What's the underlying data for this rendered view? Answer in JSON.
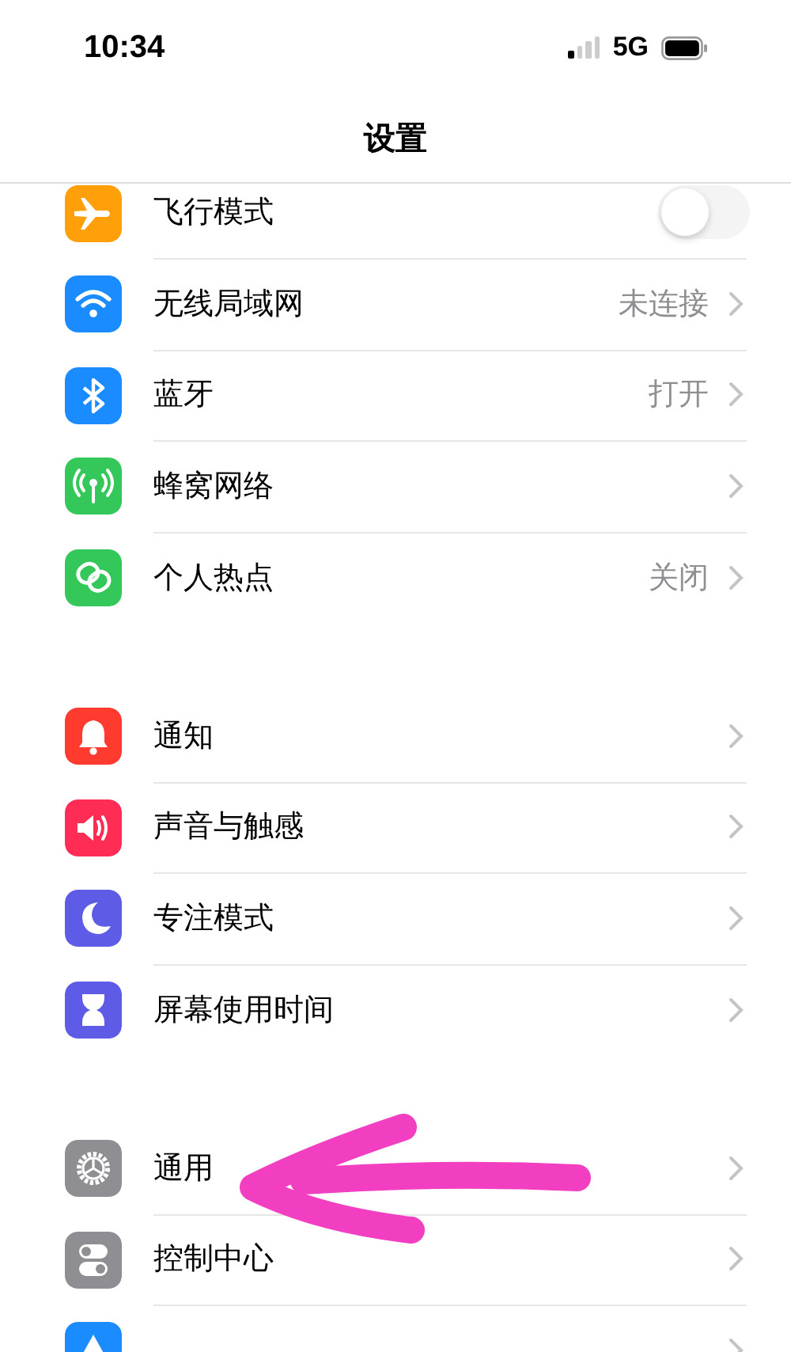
{
  "status_bar": {
    "time": "10:34",
    "network": "5G"
  },
  "nav": {
    "title": "设置"
  },
  "groups": [
    {
      "rows": [
        {
          "kind": "toggle",
          "label": "飞行模式",
          "color": "#ff9f0a",
          "on": false
        },
        {
          "kind": "link",
          "label": "无线局域网",
          "color": "#1a8cff",
          "value": "未连接"
        },
        {
          "kind": "link",
          "label": "蓝牙",
          "color": "#1a8cff",
          "value": "打开"
        },
        {
          "kind": "link",
          "label": "蜂窝网络",
          "color": "#34c759"
        },
        {
          "kind": "link",
          "label": "个人热点",
          "color": "#34c759",
          "value": "关闭"
        }
      ]
    },
    {
      "rows": [
        {
          "kind": "link",
          "label": "通知",
          "color": "#ff3b30"
        },
        {
          "kind": "link",
          "label": "声音与触感",
          "color": "#ff2d55"
        },
        {
          "kind": "link",
          "label": "专注模式",
          "color": "#5e5ce6"
        },
        {
          "kind": "link",
          "label": "屏幕使用时间",
          "color": "#5e5ce6"
        }
      ]
    },
    {
      "rows": [
        {
          "kind": "link",
          "label": "通用",
          "color": "#8e8e93"
        },
        {
          "kind": "link",
          "label": "控制中心",
          "color": "#8e8e93"
        },
        {
          "kind": "link",
          "color": "#1a8cff"
        }
      ]
    }
  ]
}
